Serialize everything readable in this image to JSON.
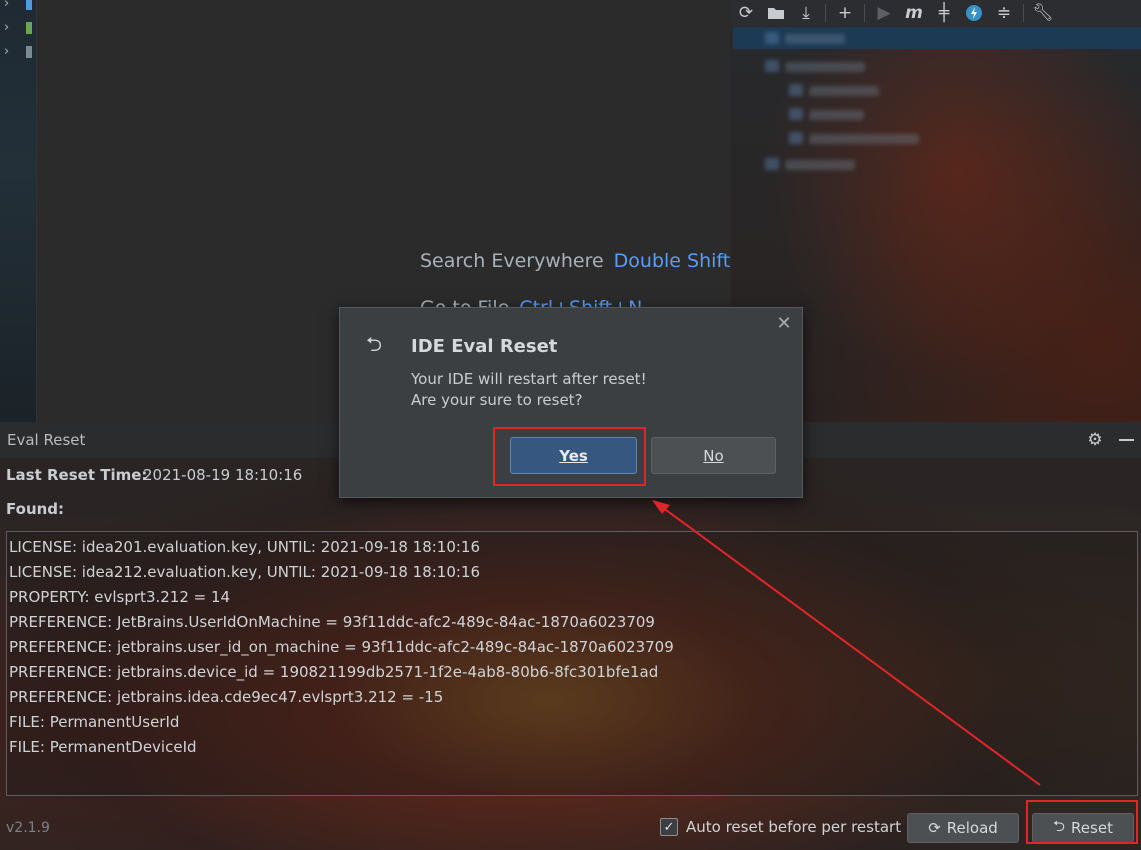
{
  "editor": {
    "hint_search_label": "Search Everywhere",
    "hint_search_key": "Double Shift",
    "hint_goto_label": "Go to File",
    "hint_goto_key": "Ctrl+Shift+N"
  },
  "tool_toolbar": {
    "icons": [
      "refresh-icon",
      "folder-sync-icon",
      "download-icon",
      "plus-icon",
      "run-icon",
      "m-icon",
      "toggle-offline-icon",
      "lightning-icon",
      "collapse-icon",
      "wrench-icon"
    ]
  },
  "bottom_window": {
    "title": "Eval Reset",
    "last_reset_label": "Last Reset Time:",
    "last_reset_value": "2021-08-19 18:10:16",
    "found_label": "Found:",
    "found_items": [
      "LICENSE: idea201.evaluation.key, UNTIL: 2021-09-18 18:10:16",
      "LICENSE: idea212.evaluation.key, UNTIL: 2021-09-18 18:10:16",
      "PROPERTY: evlsprt3.212 = 14",
      "PREFERENCE: JetBrains.UserIdOnMachine = 93f11ddc-afc2-489c-84ac-1870a6023709",
      "PREFERENCE: jetbrains.user_id_on_machine = 93f11ddc-afc2-489c-84ac-1870a6023709",
      "PREFERENCE: jetbrains.device_id = 190821199db2571-1f2e-4ab8-80b6-8fc301bfe1ad",
      "PREFERENCE: jetbrains.idea.cde9ec47.evlsprt3.212 = -15",
      "FILE: PermanentUserId",
      "FILE: PermanentDeviceId"
    ],
    "version": "v2.1.9",
    "auto_reset_label": "Auto reset before per restart",
    "auto_reset_checked": true,
    "reload_label": "Reload",
    "reset_label": "Reset"
  },
  "dialog": {
    "title": "IDE Eval Reset",
    "message_line1": "Your IDE will restart after reset!",
    "message_line2": "Are your sure to reset?",
    "yes_label": "Yes",
    "no_label": "No"
  },
  "colors": {
    "accent_blue": "#589df6",
    "primary_button": "#365880",
    "highlight_red": "#e0262a",
    "panel_bg": "#3c3f41"
  }
}
